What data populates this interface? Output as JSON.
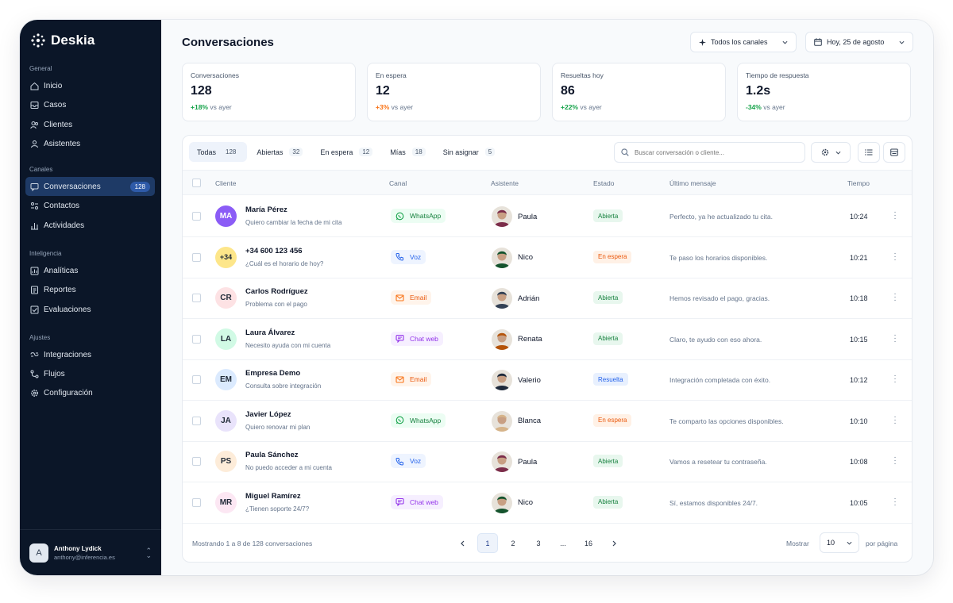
{
  "app": {
    "name": "Deskia"
  },
  "sidebar": {
    "sections": [
      {
        "title": "General",
        "items": [
          {
            "label": "Inicio",
            "icon": "home-icon"
          },
          {
            "label": "Casos",
            "icon": "inbox-icon"
          },
          {
            "label": "Clientes",
            "icon": "users-icon"
          },
          {
            "label": "Asistentes",
            "icon": "user-group-icon"
          }
        ]
      },
      {
        "title": "Canales",
        "items": [
          {
            "label": "Conversaciones",
            "icon": "chat-icon",
            "badge": "128",
            "active": true
          },
          {
            "label": "Contactos",
            "icon": "contacts-icon"
          },
          {
            "label": "Actividades",
            "icon": "activity-icon"
          }
        ]
      },
      {
        "title": "Inteligencia",
        "items": [
          {
            "label": "Analíticas",
            "icon": "analytics-icon"
          },
          {
            "label": "Reportes",
            "icon": "report-icon"
          },
          {
            "label": "Evaluaciones",
            "icon": "evaluation-icon"
          }
        ]
      },
      {
        "title": "Ajustes",
        "items": [
          {
            "label": "Integraciones",
            "icon": "integration-icon"
          },
          {
            "label": "Flujos",
            "icon": "flow-icon"
          },
          {
            "label": "Configuración",
            "icon": "settings-icon"
          }
        ]
      }
    ],
    "user": {
      "initial": "A",
      "name": "Anthony Lydick",
      "email": "anthony@inferencia.es"
    }
  },
  "header": {
    "title": "Conversaciones",
    "channel_filter": "Todos los canales",
    "date_filter": "Hoy, 25 de agosto"
  },
  "kpis": [
    {
      "label": "Conversaciones",
      "value": "128",
      "delta": "+18%",
      "delta_kind": "up",
      "suffix": "vs ayer"
    },
    {
      "label": "En espera",
      "value": "12",
      "delta": "+3%",
      "delta_kind": "warn",
      "suffix": "vs ayer"
    },
    {
      "label": "Resueltas hoy",
      "value": "86",
      "delta": "+22%",
      "delta_kind": "up",
      "suffix": "vs ayer"
    },
    {
      "label": "Tiempo de respuesta",
      "value": "1.2s",
      "delta": "-34%",
      "delta_kind": "down",
      "suffix": "vs ayer"
    }
  ],
  "tabs": [
    {
      "label": "Todas",
      "count": "128",
      "active": true
    },
    {
      "label": "Abiertas",
      "count": "32"
    },
    {
      "label": "En espera",
      "count": "12"
    },
    {
      "label": "Mías",
      "count": "18"
    },
    {
      "label": "Sin asignar",
      "count": "5"
    }
  ],
  "search": {
    "placeholder": "Buscar conversación o cliente..."
  },
  "table": {
    "columns": [
      "Cliente",
      "Canal",
      "Asistente",
      "Estado",
      "Último mensaje",
      "Tiempo"
    ],
    "rows": [
      {
        "initials": "MA",
        "avatar_bg": "#8b5cf6",
        "avatar_fg": "#ffffff",
        "name": "María Pérez",
        "subject": "Quiero cambiar la fecha de mi cita",
        "channel": "WhatsApp",
        "channel_kind": "whatsapp",
        "agent": "Paula",
        "agent_tone": "#7c2d4a",
        "status": "Abierta",
        "status_kind": "open",
        "last_message": "Perfecto, ya he actualizado tu cita.",
        "time": "10:24"
      },
      {
        "initials": "+34",
        "avatar_bg": "#fde68a",
        "avatar_fg": "#1f2937",
        "name": "+34 600 123 456",
        "subject": "¿Cuál es el horario de hoy?",
        "channel": "Voz",
        "channel_kind": "voice",
        "agent": "Nico",
        "agent_tone": "#14532d",
        "status": "En espera",
        "status_kind": "wait",
        "last_message": "Te paso los horarios disponibles.",
        "time": "10:21"
      },
      {
        "initials": "CR",
        "avatar_bg": "#fde2e4",
        "avatar_fg": "#1f2937",
        "name": "Carlos Rodríguez",
        "subject": "Problema con el pago",
        "channel": "Email",
        "channel_kind": "email",
        "agent": "Adrián",
        "agent_tone": "#334155",
        "status": "Abierta",
        "status_kind": "open",
        "last_message": "Hemos revisado el pago, gracias.",
        "time": "10:18"
      },
      {
        "initials": "LA",
        "avatar_bg": "#d1fae5",
        "avatar_fg": "#1f2937",
        "name": "Laura Álvarez",
        "subject": "Necesito ayuda con mi cuenta",
        "channel": "Chat web",
        "channel_kind": "chat",
        "agent": "Renata",
        "agent_tone": "#b45309",
        "status": "Abierta",
        "status_kind": "open",
        "last_message": "Claro, te ayudo con eso ahora.",
        "time": "10:15"
      },
      {
        "initials": "EM",
        "avatar_bg": "#dbeafe",
        "avatar_fg": "#1f2937",
        "name": "Empresa Demo",
        "subject": "Consulta sobre integración",
        "channel": "Email",
        "channel_kind": "email",
        "agent": "Valerio",
        "agent_tone": "#1e293b",
        "status": "Resuelta",
        "status_kind": "done",
        "last_message": "Integración completada con éxito.",
        "time": "10:12"
      },
      {
        "initials": "JA",
        "avatar_bg": "#e9e3fb",
        "avatar_fg": "#1f2937",
        "name": "Javier López",
        "subject": "Quiero renovar mi plan",
        "channel": "WhatsApp",
        "channel_kind": "whatsapp",
        "agent": "Blanca",
        "agent_tone": "#d6b48a",
        "status": "En espera",
        "status_kind": "wait",
        "last_message": "Te comparto las opciones disponibles.",
        "time": "10:10"
      },
      {
        "initials": "PS",
        "avatar_bg": "#fdecd9",
        "avatar_fg": "#1f2937",
        "name": "Paula Sánchez",
        "subject": "No puedo acceder a mi cuenta",
        "channel": "Voz",
        "channel_kind": "voice",
        "agent": "Paula",
        "agent_tone": "#7c2d4a",
        "status": "Abierta",
        "status_kind": "open",
        "last_message": "Vamos a resetear tu contraseña.",
        "time": "10:08"
      },
      {
        "initials": "MR",
        "avatar_bg": "#fce7f3",
        "avatar_fg": "#1f2937",
        "name": "Miguel Ramírez",
        "subject": "¿Tienen soporte 24/7?",
        "channel": "Chat web",
        "channel_kind": "chat",
        "agent": "Nico",
        "agent_tone": "#14532d",
        "status": "Abierta",
        "status_kind": "open",
        "last_message": "Sí, estamos disponibles 24/7.",
        "time": "10:05"
      }
    ]
  },
  "footer": {
    "summary": "Mostrando 1 a 8 de 128 conversaciones",
    "pages": [
      "1",
      "2",
      "3",
      "...",
      "16"
    ],
    "current_page": "1",
    "show_label": "Mostrar",
    "per_page": "10",
    "per_page_label": "por página"
  },
  "colors": {
    "sidebar_bg": "#0b1628",
    "accent": "#1e3a66",
    "whatsapp": "#16a34a",
    "voice": "#2563eb",
    "email": "#f97316",
    "chat": "#9333ea"
  }
}
